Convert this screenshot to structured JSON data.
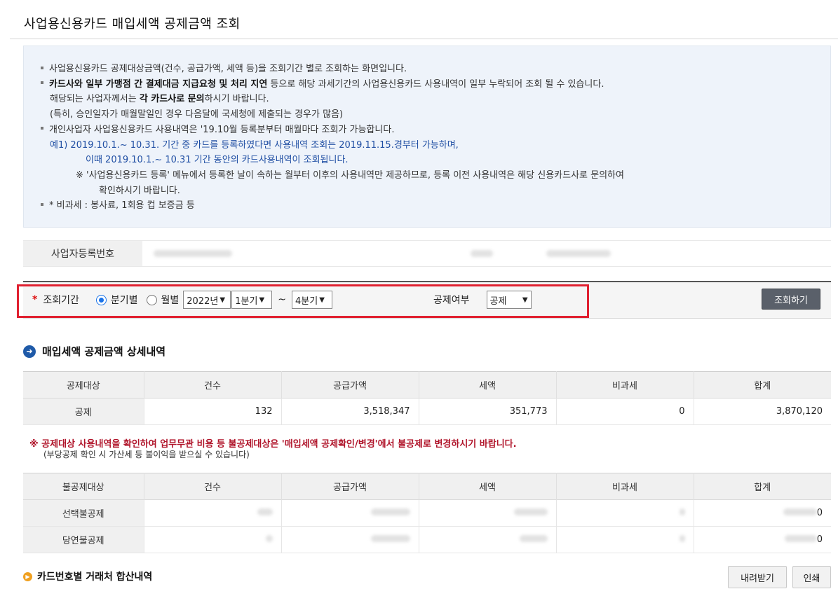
{
  "page": {
    "title": "사업용신용카드 매입세액 공제금액 조회"
  },
  "info": {
    "line1": "사업용신용카드 공제대상금액(건수, 공급가액, 세액 등)을 조회기간 별로 조회하는 화면입니다.",
    "line2_bold": "카드사와 일부 가맹점 간 결제대금 지급요청 및 처리 지연",
    "line2_rest": " 등으로 해당 과세기간의 사업용신용카드 사용내역이 일부 누락되어 조회 될 수 있습니다.",
    "line3_pre": "해당되는 사업자께서는 ",
    "line3_bold": "각 카드사로 문의",
    "line3_post": "하시기 바랍니다.",
    "line4": "(특히, 승인일자가 매월말일인 경우 다음달에 국세청에 제출되는 경우가 많음)",
    "line5": "개인사업자 사업용신용카드 사용내역은 '19.10월 등록분부터 매월마다 조회가 가능합니다.",
    "line6": "예1) 2019.10.1.~ 10.31. 기간 중 카드를 등록하였다면 사용내역 조회는 2019.11.15.경부터 가능하며,",
    "line7": "이때 2019.10.1.~ 10.31 기간 동안의 카드사용내역이 조회됩니다.",
    "line8": "※ '사업용신용카드 등록' 메뉴에서 등록한 날이 속하는 월부터 이후의 사용내역만 제공하므로, 등록 이전 사용내역은 해당 신용카드사로 문의하여",
    "line9": "확인하시기 바랍니다.",
    "line10": "* 비과세 : 봉사료, 1회용 컵 보증금 등"
  },
  "business": {
    "label": "사업자등록번호"
  },
  "search": {
    "period_label": "조회기간",
    "req_mark": "*",
    "radio_quarter": "분기별",
    "radio_month": "월별",
    "year": "2022년",
    "from_quarter": "1분기",
    "tilde": "~",
    "to_quarter": "4분기",
    "deduct_label": "공제여부",
    "deduct_value": "공제",
    "submit": "조회하기"
  },
  "detail": {
    "heading": "매입세액 공제금액 상세내역",
    "headers": [
      "공제대상",
      "건수",
      "공급가액",
      "세액",
      "비과세",
      "합계"
    ],
    "row": [
      "공제",
      "132",
      "3,518,347",
      "351,773",
      "0",
      "3,870,120"
    ]
  },
  "warning": {
    "main": "※ 공제대상 사용내역을 확인하여 업무무관 비용 등 불공제대상은 '매입세액 공제확인/변경'에서 불공제로 변경하시기 바랍니다.",
    "sub": "(부당공제 확인 시 가산세 등 불이익을 받으실 수 있습니다)"
  },
  "nondeduct": {
    "headers": [
      "불공제대상",
      "건수",
      "공급가액",
      "세액",
      "비과세",
      "합계"
    ],
    "rows": [
      {
        "label": "선택불공제",
        "tail": "0"
      },
      {
        "label": "당연불공제",
        "tail": "0"
      }
    ]
  },
  "card": {
    "heading": "카드번호별 거래처 합산내역",
    "download": "내려받기",
    "print": "인쇄"
  }
}
